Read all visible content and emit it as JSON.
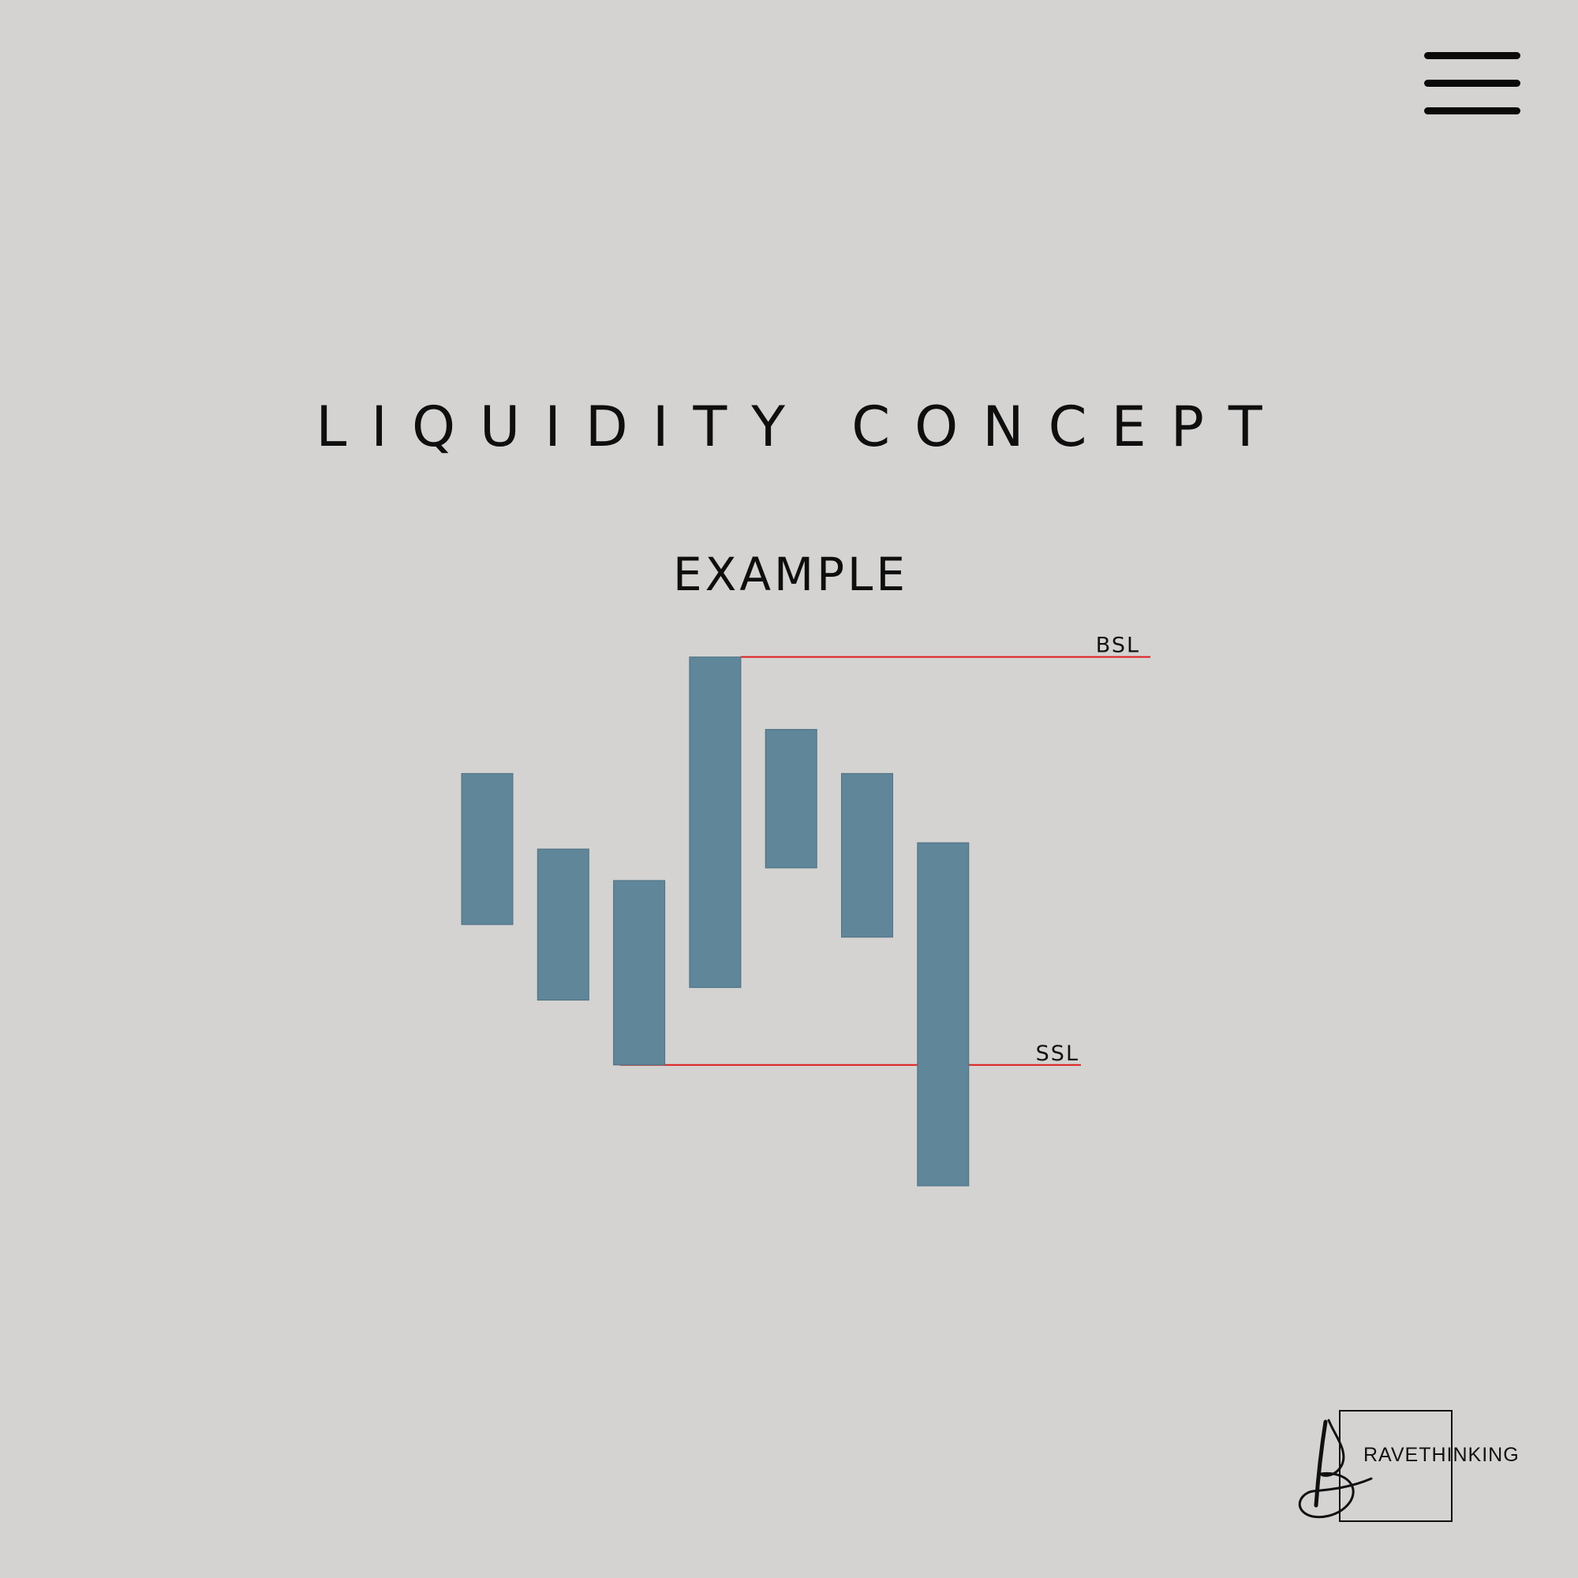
{
  "header": {
    "menu_icon": "hamburger-menu-icon"
  },
  "title": "LIQUIDITY CONCEPT",
  "subtitle": "EXAMPLE",
  "diagram": {
    "candle_color": "#5f8699",
    "level_color": "#e01b1b",
    "candles": [
      {
        "top": 8.45,
        "bottom": 6.05
      },
      {
        "top": 7.25,
        "bottom": 4.85
      },
      {
        "top": 6.75,
        "bottom": 3.82
      },
      {
        "top": 10.3,
        "bottom": 5.05
      },
      {
        "top": 9.15,
        "bottom": 6.95
      },
      {
        "top": 8.45,
        "bottom": 5.85
      },
      {
        "top": 7.35,
        "bottom": 1.9
      }
    ],
    "levels": [
      {
        "label": "BSL",
        "value": 10.3
      },
      {
        "label": "SSL",
        "value": 3.82
      }
    ]
  },
  "logo": {
    "text": "RAVETHINKING",
    "monogram": "B"
  }
}
